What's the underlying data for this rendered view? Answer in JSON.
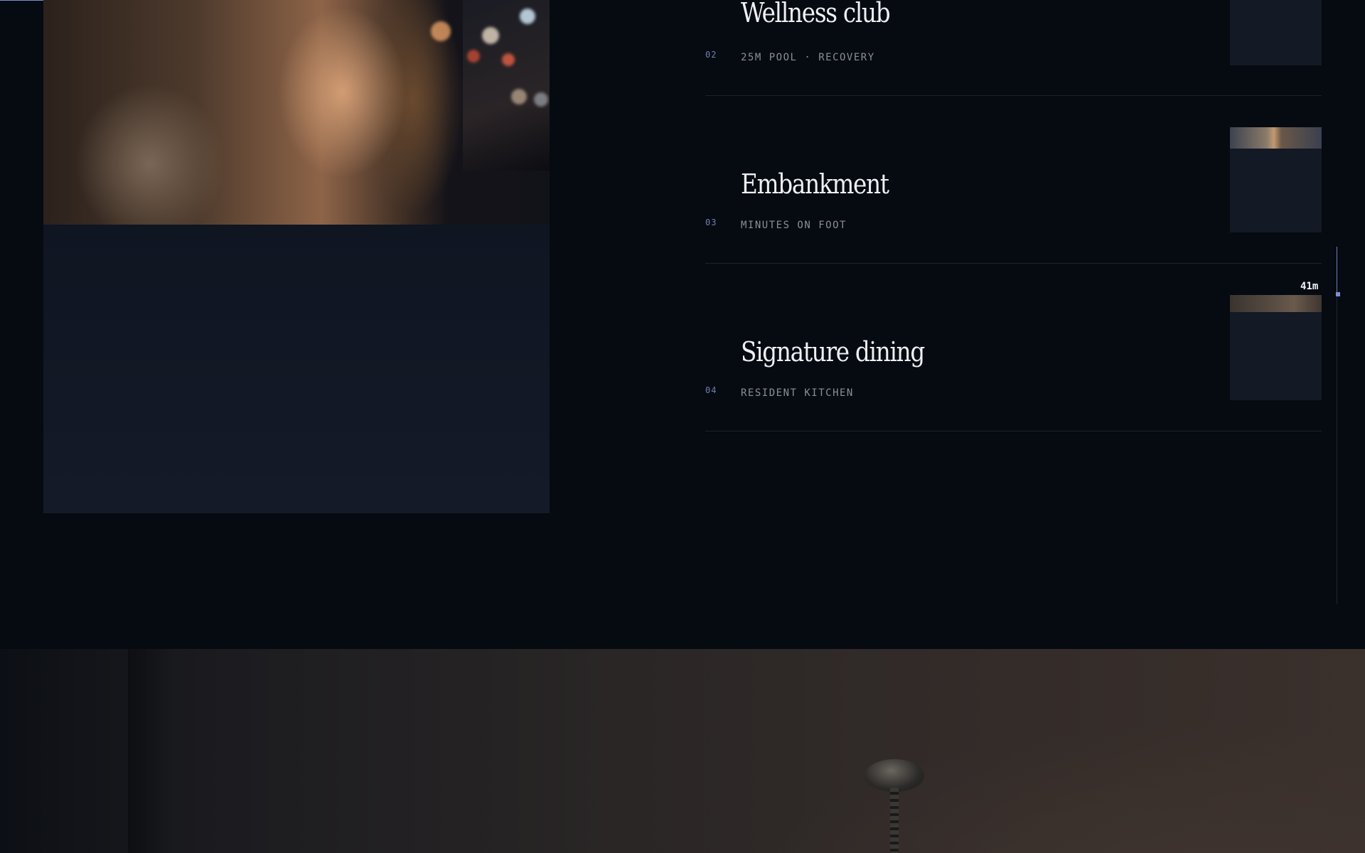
{
  "amenities": [
    {
      "number": "02",
      "title": "Wellness club",
      "subtitle": "25M POOL · RECOVERY"
    },
    {
      "number": "03",
      "title": "Embankment",
      "subtitle": "MINUTES ON FOOT"
    },
    {
      "number": "04",
      "title": "Signature dining",
      "subtitle": "RESIDENT KITCHEN"
    }
  ],
  "scroll_indicator": {
    "label": "41m"
  },
  "colors": {
    "background": "#060a11",
    "accent": "#7b8fd0",
    "title_text": "#eef0f3",
    "subtitle_text": "#8a8f99"
  },
  "icons": {
    "hero_fixture": "chandelier-icon"
  }
}
